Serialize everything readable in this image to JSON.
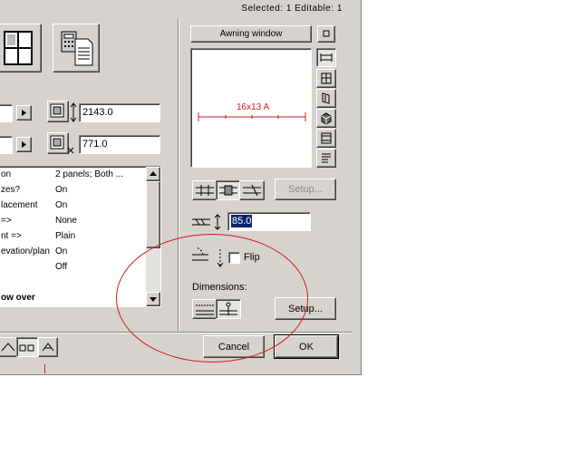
{
  "status_bar": "Selected: 1 Editable: 1",
  "left_panel": {
    "height_value": "2143.0",
    "width_value": "771.0",
    "params": [
      {
        "name": "on",
        "value": "2 panels; Both ..."
      },
      {
        "name": "zes?",
        "value": "On"
      },
      {
        "name": "lacement",
        "value": "On"
      },
      {
        "name": "=>",
        "value": "None"
      },
      {
        "name": "nt =>",
        "value": "Plain"
      },
      {
        "name": "evation/plan",
        "value": "On"
      },
      {
        "name": "",
        "value": "Off"
      }
    ],
    "params_footer": "ow over"
  },
  "right_panel": {
    "window_name": "Awning window",
    "preview_label": "16x13 A",
    "setup_label_1": "Setup...",
    "offset_value": "85.0",
    "flip_label": "Flip",
    "dimensions_label": "Dimensions:",
    "setup_label_2": "Setup..."
  },
  "buttons": {
    "cancel": "Cancel",
    "ok": "OK"
  },
  "colors": {
    "dialog_bg": "#d6d3ce",
    "annotation": "#d01818",
    "preview_red": "#c81e1e"
  }
}
